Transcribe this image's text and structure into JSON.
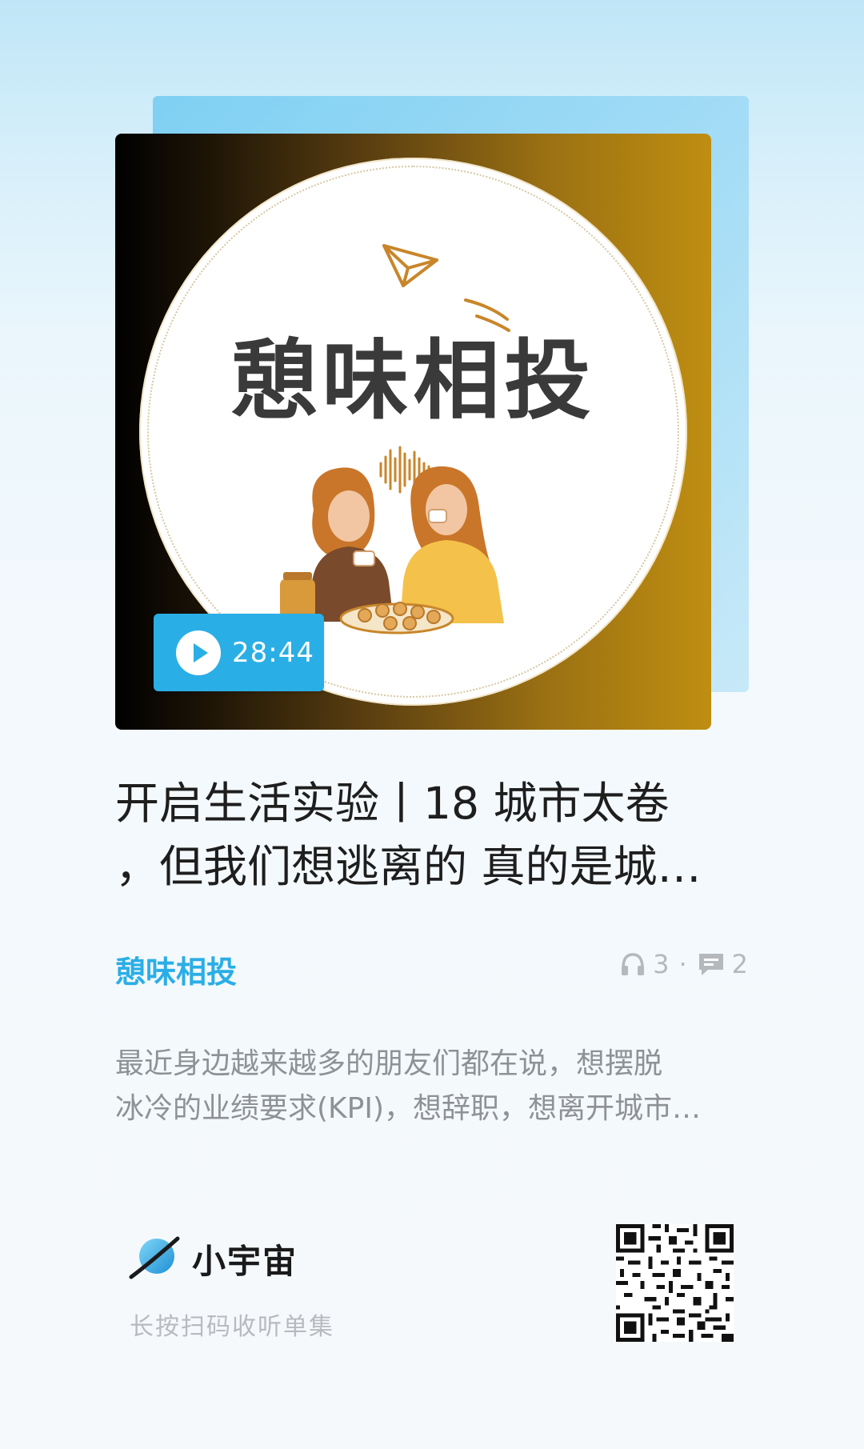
{
  "cover": {
    "logo_title": "憩味相投",
    "duration": "28:44",
    "colors": {
      "accent": "#2aaee6",
      "gold": "#bf8e12"
    }
  },
  "episode": {
    "title_lines": [
      "开启生活实验丨18 城市太卷",
      "，但我们想逃离的 真的是城…"
    ],
    "podcast_name": "憩味相投",
    "listens": "3",
    "comments": "2",
    "description_lines": [
      "最近身边越来越多的朋友们都在说，想摆脱",
      "冰冷的业绩要求(KPI)，想辞职，想离开城市…"
    ]
  },
  "footer": {
    "brand_name": "小宇宙",
    "hint": "长按扫码收听单集"
  },
  "icons": [
    "play-icon",
    "headphones-icon",
    "comment-icon",
    "planet-logo-icon",
    "paper-plane-icon",
    "sound-wave-icon",
    "qr-code-icon"
  ]
}
